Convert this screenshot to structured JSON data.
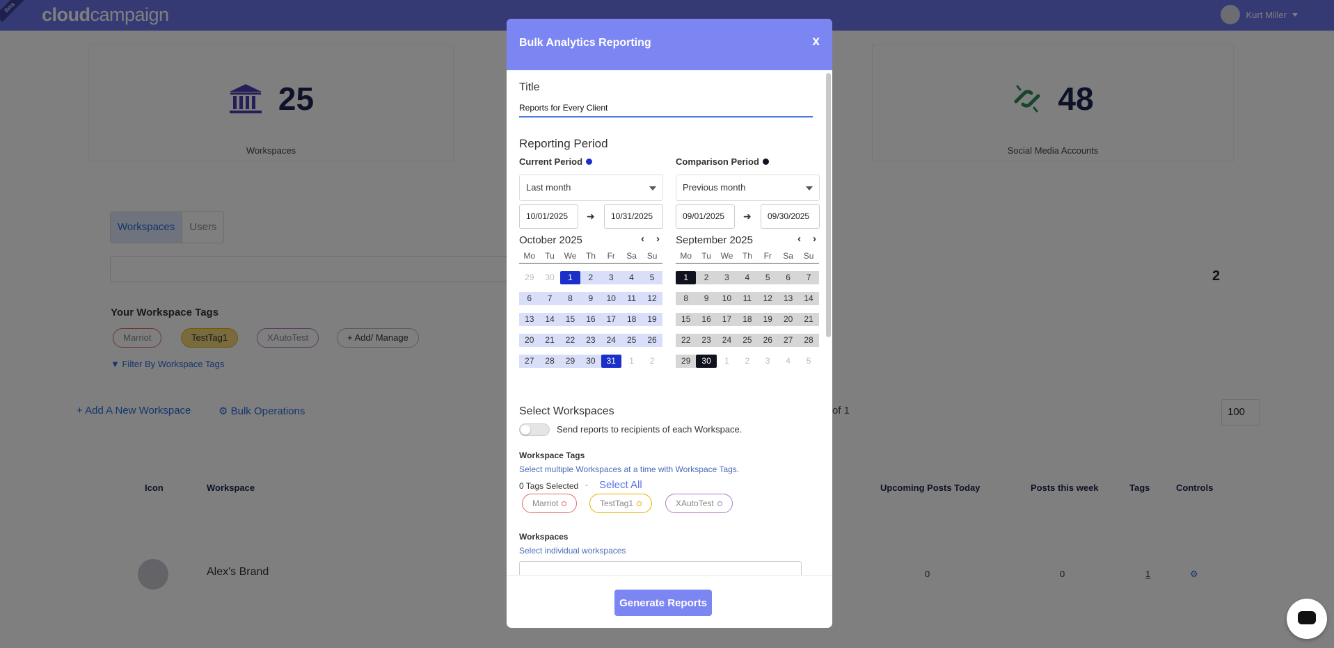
{
  "app": {
    "logo_bold": "cloud",
    "logo_light": "campaign",
    "ribbon": "Beta",
    "user_name": "Kurt Miller"
  },
  "stats": [
    {
      "value": "25",
      "label": "Workspaces",
      "icon": "bank-icon"
    },
    {
      "value": "48",
      "label": "Social Media Accounts",
      "icon": "chain-link-icon"
    }
  ],
  "page": {
    "tabs": [
      "Workspaces",
      "Users"
    ],
    "tags_title": "Your Workspace Tags",
    "tags": [
      {
        "label": "Marriot",
        "color": "#e06a6a"
      },
      {
        "label": "TestTag1",
        "color": "#e2b400"
      },
      {
        "label": "XAutoTest",
        "color": "#b07cc6"
      }
    ],
    "add_manage": "+ Add/ Manage",
    "filter_link": "Filter By Workspace Tags",
    "add_workspace": "+ Add A New Workspace",
    "bulk_operations": "Bulk Operations",
    "page_of": "of 1",
    "count": "2",
    "page_size": "100",
    "columns": [
      "Icon",
      "Workspace",
      "Upcoming Posts Today",
      "Posts this week",
      "Tags",
      "Controls"
    ],
    "row": {
      "name": "Alex's Brand",
      "upcoming": "0",
      "week": "0",
      "tags": "1"
    }
  },
  "modal": {
    "title": "Bulk Analytics Reporting",
    "close": "x",
    "title_label": "Title",
    "title_value": "Reports for Every Client",
    "reporting_period_label": "Reporting Period",
    "current": {
      "label": "Current Period",
      "dot_color": "#1b2fc9",
      "preset": "Last month",
      "start": "10/01/2025",
      "end": "10/31/2025",
      "month_title": "October 2025"
    },
    "comparison": {
      "label": "Comparison Period",
      "dot_color": "#10131e",
      "preset": "Previous month",
      "start": "09/01/2025",
      "end": "09/30/2025",
      "month_title": "September 2025"
    },
    "weekdays": [
      "Mo",
      "Tu",
      "We",
      "Th",
      "Fr",
      "Sa",
      "Su"
    ],
    "select_workspaces_label": "Select Workspaces",
    "toggle_label": "Send reports to recipients of each Workspace.",
    "workspace_tags_label": "Workspace Tags",
    "workspace_tags_sub": "Select multiple Workspaces at a time with Workspace Tags.",
    "tags_selected": "0 Tags Selected",
    "separator": "-",
    "select_all": "Select All",
    "workspaces_label": "Workspaces",
    "workspaces_sub": "Select individual workspaces",
    "generate_button": "Generate Reports"
  },
  "colors": {
    "header": "#7c86f2",
    "topbar": "#6b72e8",
    "current_selected": "#1b2fc9",
    "comparison_selected": "#10131e"
  }
}
